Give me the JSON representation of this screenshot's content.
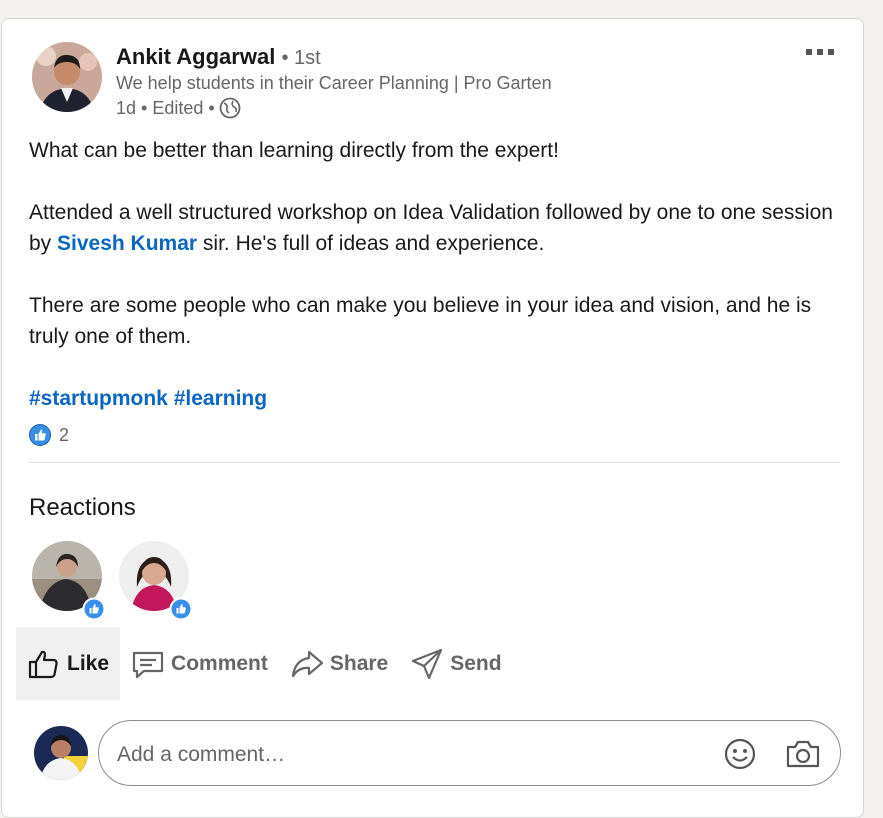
{
  "author": {
    "name": "Ankit Aggarwal",
    "degree": "• 1st",
    "headline": "We help students in their Career Planning | Pro Garten",
    "meta": "1d • Edited •"
  },
  "post": {
    "line1": "What can be better than learning directly from the expert!",
    "para2_start": "Attended a well structured workshop on Idea Validation followed by one to one session by ",
    "mention": "Sivesh Kumar",
    "para2_end": " sir. He's full of ideas and experience.",
    "para3": "There are some people who can make you believe in your idea and vision, and he is truly one of them.",
    "hashtag1": "#startupmonk",
    "hashtag2": "#learning"
  },
  "likes": {
    "count": "2"
  },
  "reactions": {
    "title": "Reactions"
  },
  "actions": {
    "like": "Like",
    "comment": "Comment",
    "share": "Share",
    "send": "Send"
  },
  "comment": {
    "placeholder": "Add a comment…"
  },
  "colors": {
    "link": "#0a66c2",
    "muted": "#666666",
    "text": "#191919"
  },
  "icons": [
    "more-options-icon",
    "globe-icon",
    "like-reaction-icon",
    "like-icon",
    "comment-icon",
    "share-icon",
    "send-icon",
    "emoji-icon",
    "camera-icon"
  ]
}
